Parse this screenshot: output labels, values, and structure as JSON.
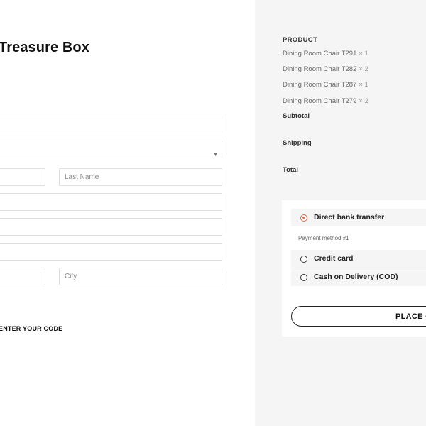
{
  "store": {
    "title": "Treasure Box"
  },
  "form": {
    "field1": {
      "placeholder": "",
      "value": ""
    },
    "country_select": {
      "selected": ""
    },
    "first_name": {
      "placeholder": "",
      "value": ""
    },
    "last_name": {
      "placeholder": "Last Name",
      "value": ""
    },
    "field5": {
      "placeholder": "",
      "value": ""
    },
    "field6": {
      "placeholder": "",
      "value": ""
    },
    "field7": {
      "placeholder": "",
      "value": ""
    },
    "field8": {
      "placeholder": "",
      "value": ""
    },
    "city": {
      "placeholder": "City",
      "value": ""
    }
  },
  "coupon": {
    "label": "ENTER YOUR CODE"
  },
  "order_summary": {
    "product_header": "PRODUCT",
    "items": [
      {
        "name": "Dining Room Chair T291",
        "qty": "× 1"
      },
      {
        "name": "Dining Room Chair T282",
        "qty": "× 2"
      },
      {
        "name": "Dining Room Chair T287",
        "qty": "× 1"
      },
      {
        "name": "Dining Room Chair T279",
        "qty": "× 2"
      }
    ],
    "subtotal_label": "Subtotal",
    "shipping_label": "Shipping",
    "total_label": "Total"
  },
  "payment": {
    "methods": [
      {
        "label": "Direct bank transfer",
        "selected": true,
        "description": "Payment method #1"
      },
      {
        "label": "Credit card",
        "selected": false
      },
      {
        "label": "Cash on Delivery (COD)",
        "selected": false
      }
    ],
    "place_order_label": "PLACE ORDER"
  },
  "colors": {
    "accent": "#e8663d",
    "panel_bg": "#f5f5f5",
    "border": "#dedede"
  }
}
